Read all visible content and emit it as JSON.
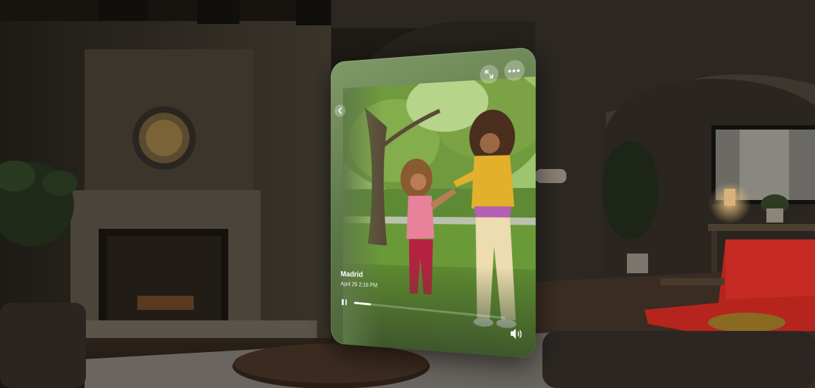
{
  "video": {
    "title": "Madrid",
    "date": "April 29 2:16 PM",
    "progress": 0.12
  },
  "controls": {
    "back_icon": "chevron-left-icon",
    "expand_icon": "expand-arrows-icon",
    "more_icon": "ellipsis-icon",
    "more_glyph": "•••",
    "play_state_icon": "pause-icon",
    "volume_icon": "speaker-volume-icon"
  },
  "colors": {
    "window_tint": "#5f7a49",
    "room": "#1c1914",
    "armchair": "#b5241d"
  }
}
